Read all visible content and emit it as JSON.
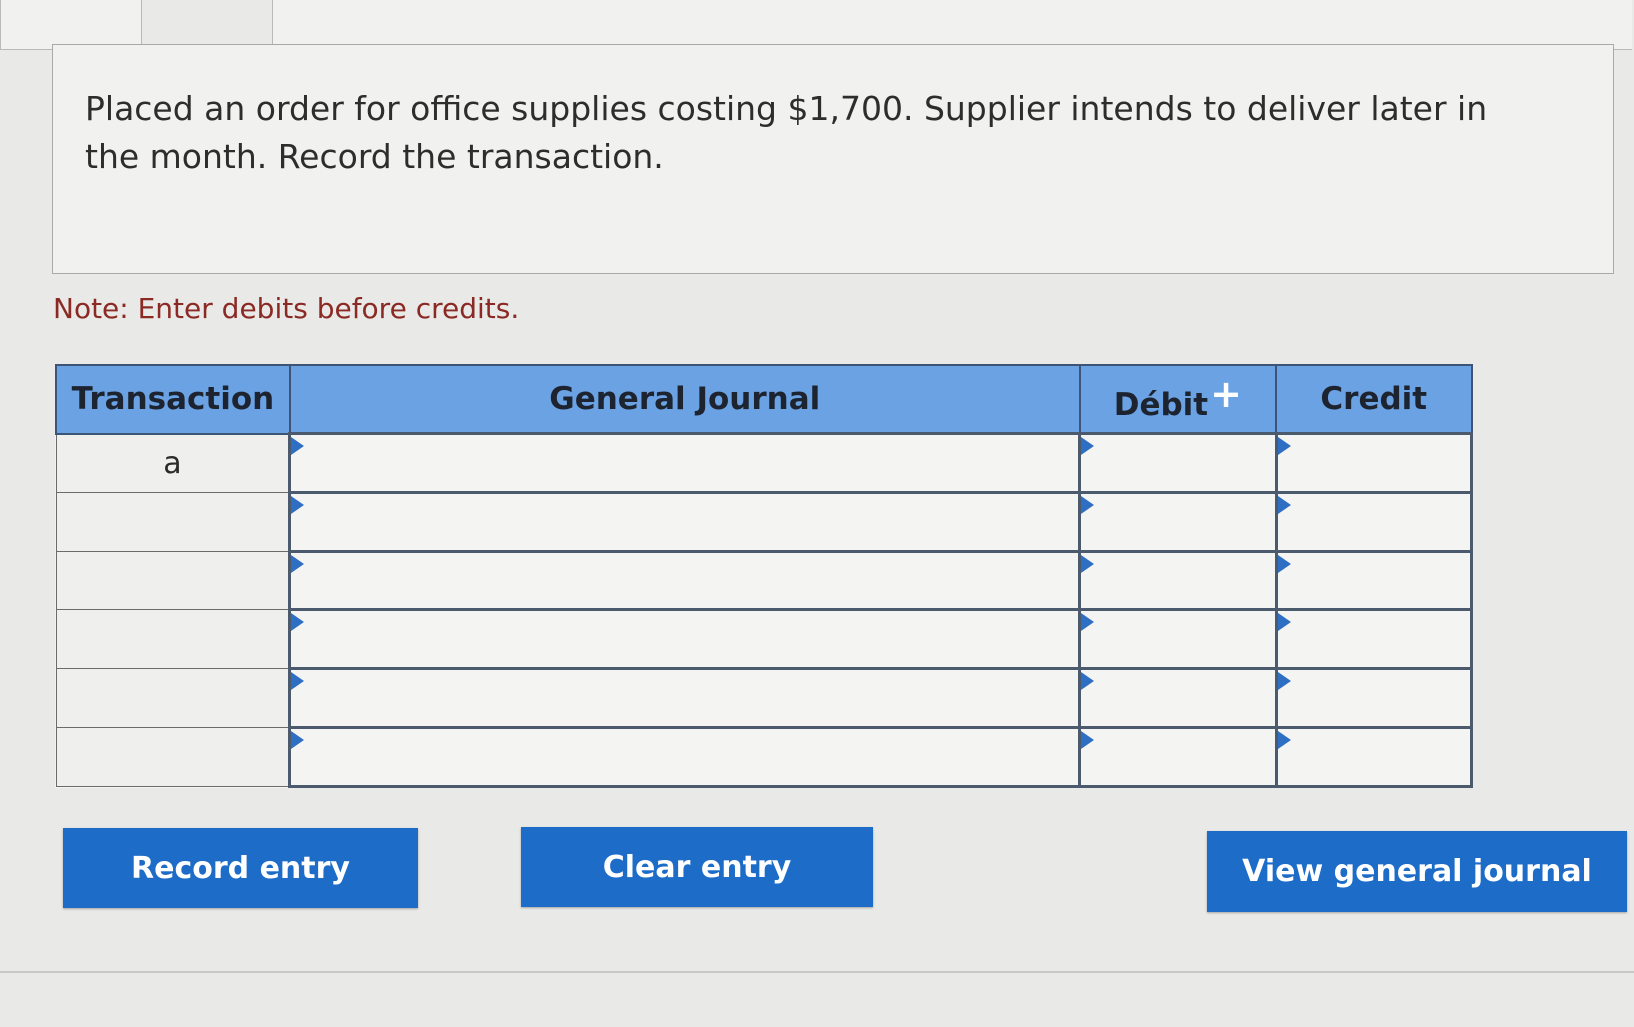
{
  "question": {
    "text": "Placed an order for office supplies costing $1,700. Supplier intends to deliver later in the month. Record the transaction."
  },
  "note": "Note: Enter debits before credits.",
  "journal": {
    "headers": {
      "transaction": "Transaction",
      "general_journal": "General Journal",
      "debit": "Débit",
      "credit": "Credit"
    },
    "rows": [
      {
        "transaction": "a",
        "account": "",
        "debit": "",
        "credit": ""
      },
      {
        "transaction": "",
        "account": "",
        "debit": "",
        "credit": ""
      },
      {
        "transaction": "",
        "account": "",
        "debit": "",
        "credit": ""
      },
      {
        "transaction": "",
        "account": "",
        "debit": "",
        "credit": ""
      },
      {
        "transaction": "",
        "account": "",
        "debit": "",
        "credit": ""
      },
      {
        "transaction": "",
        "account": "",
        "debit": "",
        "credit": ""
      }
    ]
  },
  "buttons": {
    "record": "Record entry",
    "clear": "Clear entry",
    "view": "View general journal"
  },
  "colors": {
    "header_bg": "#6aa2e4",
    "button_bg": "#1d6cc8",
    "note_text": "#8b2a25",
    "cell_marker": "#2f6fc3"
  },
  "icons": {
    "header_cursor": "plus-icon",
    "cell_marker": "triangle-marker-icon"
  }
}
